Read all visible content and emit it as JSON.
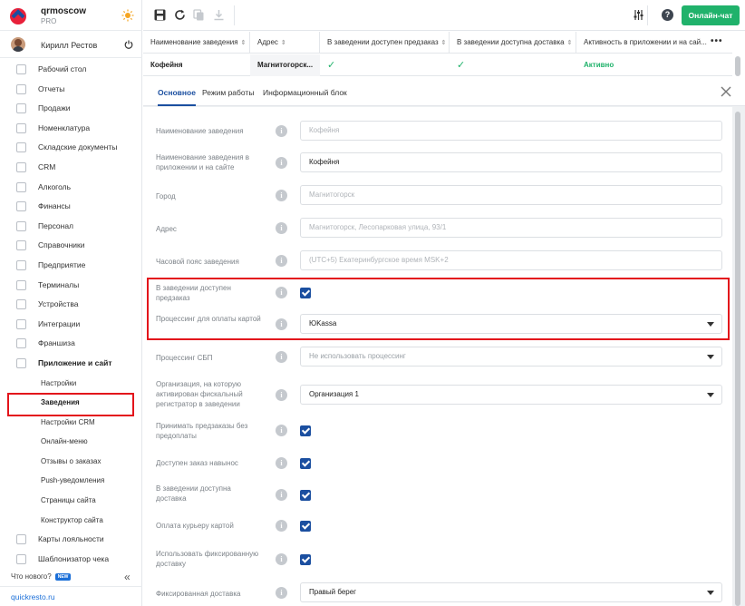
{
  "brand": {
    "name": "qrmoscow",
    "plan": "PRO"
  },
  "user": {
    "name": "Кирилл Рестов"
  },
  "sidebar": {
    "items": [
      {
        "label": "Рабочий стол"
      },
      {
        "label": "Отчеты"
      },
      {
        "label": "Продажи"
      },
      {
        "label": "Номенклатура"
      },
      {
        "label": "Складские документы"
      },
      {
        "label": "CRM"
      },
      {
        "label": "Алкоголь"
      },
      {
        "label": "Финансы"
      },
      {
        "label": "Персонал"
      },
      {
        "label": "Справочники"
      },
      {
        "label": "Предприятие"
      },
      {
        "label": "Терминалы"
      },
      {
        "label": "Устройства"
      },
      {
        "label": "Интеграции"
      },
      {
        "label": "Франшиза"
      },
      {
        "label": "Приложение и сайт"
      }
    ],
    "subitems": [
      {
        "label": "Настройки"
      },
      {
        "label": "Заведения"
      },
      {
        "label": "Настройки CRM"
      },
      {
        "label": "Онлайн-меню"
      },
      {
        "label": "Отзывы о заказах"
      },
      {
        "label": "Push-уведомления"
      },
      {
        "label": "Страницы сайта"
      },
      {
        "label": "Конструктор сайта"
      }
    ],
    "items_after": [
      {
        "label": "Карты лояльности"
      },
      {
        "label": "Шаблонизатор чека"
      }
    ],
    "whats_new": "Что нового?",
    "new_badge": "NEW",
    "footer_link": "quickresto.ru"
  },
  "toolbar": {
    "chat_label": "Онлайн-чат",
    "help": "?"
  },
  "table": {
    "headers": [
      "Наименование заведения",
      "Адрес",
      "В заведении доступен предзаказ",
      "В заведении доступна доставка",
      "Активность в приложении и на сай..."
    ],
    "row": {
      "name": "Кофейня",
      "address": "Магнитогорск...",
      "preorder": "✓",
      "delivery": "✓",
      "activity": "Активно"
    }
  },
  "tabs": [
    "Основное",
    "Режим работы",
    "Информационный блок"
  ],
  "form": {
    "name_label": "Наименование заведения",
    "name_value": "Кофейня",
    "app_name_label": "Наименование заведения в приложении и на сайте",
    "app_name_value": "Кофейня",
    "city_label": "Город",
    "city_value": "Магнитогорск",
    "address_label": "Адрес",
    "address_value": "Магнитогорск, Лесопарковая улица, 93/1",
    "tz_label": "Часовой пояс заведения",
    "tz_value": "(UTC+5) Екатеринбургское время MSK+2",
    "preorder_label": "В заведении доступен предзаказ",
    "card_proc_label": "Процессинг для оплаты картой",
    "card_proc_value": "ЮKassa",
    "sbp_label": "Процессинг СБП",
    "sbp_value": "Не использовать процессинг",
    "org_label": "Организация, на которую активирован фискальный регистратор в заведении",
    "org_value": "Организация 1",
    "no_prepay_label": "Принимать предзаказы без предоплаты",
    "takeaway_label": "Доступен заказ навынос",
    "delivery_label": "В заведении доступна доставка",
    "courier_card_label": "Оплата курьеру картой",
    "fixed_delivery_use_label": "Использовать фиксированную доставку",
    "fixed_delivery_label": "Фиксированная доставка",
    "fixed_delivery_value": "Правый берег"
  }
}
